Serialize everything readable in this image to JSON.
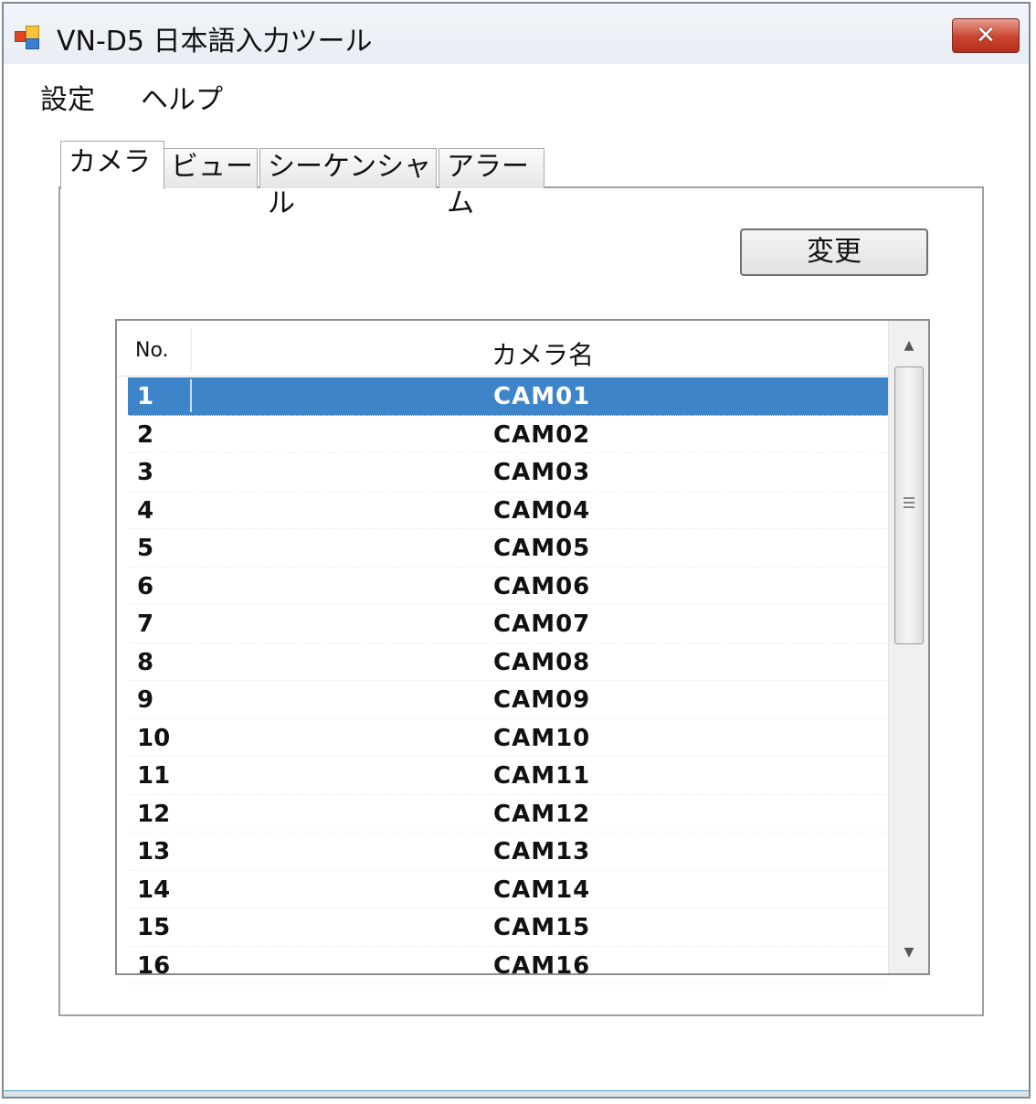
{
  "window": {
    "title": "VN-D5 日本語入力ツール",
    "close_glyph": "✕"
  },
  "menu": {
    "items": [
      "設定",
      "ヘルプ"
    ]
  },
  "tabs": [
    {
      "label": "カメラ",
      "active": true
    },
    {
      "label": "ビュー",
      "active": false
    },
    {
      "label": "シーケンシャル",
      "active": false
    },
    {
      "label": "アラーム",
      "active": false
    }
  ],
  "camera_tab": {
    "change_button": "変更",
    "columns": {
      "no": "No.",
      "name": "カメラ名"
    },
    "rows": [
      {
        "no": "1",
        "name": "CAM01",
        "selected": true
      },
      {
        "no": "2",
        "name": "CAM02"
      },
      {
        "no": "3",
        "name": "CAM03"
      },
      {
        "no": "4",
        "name": "CAM04"
      },
      {
        "no": "5",
        "name": "CAM05"
      },
      {
        "no": "6",
        "name": "CAM06"
      },
      {
        "no": "7",
        "name": "CAM07"
      },
      {
        "no": "8",
        "name": "CAM08"
      },
      {
        "no": "9",
        "name": "CAM09"
      },
      {
        "no": "10",
        "name": "CAM10"
      },
      {
        "no": "11",
        "name": "CAM11"
      },
      {
        "no": "12",
        "name": "CAM12"
      },
      {
        "no": "13",
        "name": "CAM13"
      },
      {
        "no": "14",
        "name": "CAM14"
      },
      {
        "no": "15",
        "name": "CAM15"
      },
      {
        "no": "16",
        "name": "CAM16"
      }
    ]
  },
  "scrollbar": {
    "up_glyph": "▲",
    "down_glyph": "▼"
  },
  "colors": {
    "selection": "#3d84c8",
    "close_button": "#c9432e"
  },
  "icons": {
    "app": "app-icon",
    "close": "close-icon",
    "scroll_up": "scroll-up-icon",
    "scroll_down": "scroll-down-icon"
  }
}
